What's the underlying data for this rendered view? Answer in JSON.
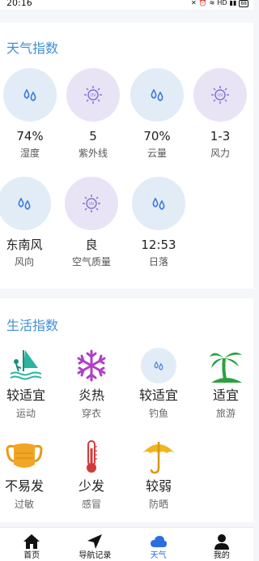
{
  "status_bar": {
    "time": "20:16",
    "battery": "88",
    "network": "HD"
  },
  "weather_index": {
    "title": "天气指数",
    "items": [
      {
        "value": "74%",
        "label": "湿度",
        "icon": "water-drops-icon",
        "tone": "blue"
      },
      {
        "value": "5",
        "label": "紫外线",
        "icon": "uv-sun-icon",
        "tone": "purple"
      },
      {
        "value": "70%",
        "label": "云量",
        "icon": "water-drops-icon",
        "tone": "blue"
      },
      {
        "value": "1-3",
        "label": "风力",
        "icon": "uv-sun-icon",
        "tone": "purple"
      },
      {
        "value": "东南风",
        "label": "风向",
        "icon": "water-drops-icon",
        "tone": "blue"
      },
      {
        "value": "良",
        "label": "空气质量",
        "icon": "uv-sun-icon",
        "tone": "purple"
      },
      {
        "value": "12:53",
        "label": "日落",
        "icon": "water-drops-icon",
        "tone": "blue"
      }
    ]
  },
  "life_index": {
    "title": "生活指数",
    "items": [
      {
        "value": "较适宜",
        "label": "运动",
        "icon": "windsurf-icon"
      },
      {
        "value": "炎热",
        "label": "穿衣",
        "icon": "snowflake-icon"
      },
      {
        "value": "较适宜",
        "label": "钓鱼",
        "icon": "water-drops-icon"
      },
      {
        "value": "适宜",
        "label": "旅游",
        "icon": "palm-island-icon"
      },
      {
        "value": "不易发",
        "label": "过敏",
        "icon": "mask-icon"
      },
      {
        "value": "少发",
        "label": "感冒",
        "icon": "thermometer-icon"
      },
      {
        "value": "较弱",
        "label": "防晒",
        "icon": "umbrella-icon"
      }
    ]
  },
  "tabs": [
    {
      "label": "首页",
      "icon": "home-icon",
      "active": false
    },
    {
      "label": "导航记录",
      "icon": "navigation-arrow-icon",
      "active": false
    },
    {
      "label": "天气",
      "icon": "cloud-icon",
      "active": true
    },
    {
      "label": "我的",
      "icon": "person-icon",
      "active": false
    }
  ],
  "colors": {
    "accent": "#3f8fd8",
    "active_tab": "#2a6fe0",
    "blue_circle": "#e2ecf7",
    "purple_circle": "#e8e4f5"
  }
}
